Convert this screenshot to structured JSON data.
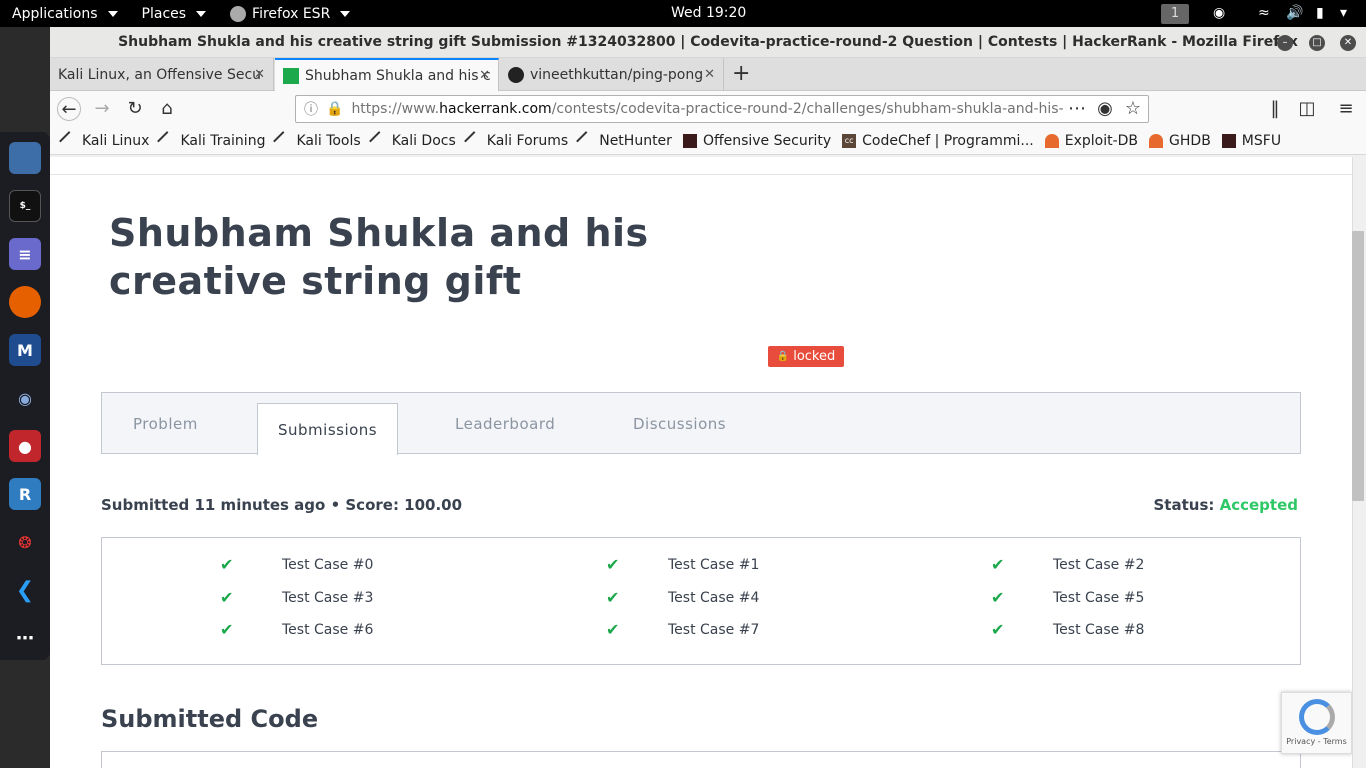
{
  "system": {
    "applications": "Applications",
    "places": "Places",
    "firefox_menu": "Firefox ESR",
    "clock": "Wed 19:20",
    "workspace": "1"
  },
  "window": {
    "title": "Shubham Shukla and his creative string gift Submission #1324032800 | Codevita-practice-round-2 Question | Contests | HackerRank - Mozilla Firefox"
  },
  "tabs": [
    {
      "label": "Kali Linux, an Offensive Secu"
    },
    {
      "label": "Shubham Shukla and his c"
    },
    {
      "label": "vineethkuttan/ping-pong"
    }
  ],
  "url": {
    "prefix": "https://www.",
    "domain": "hackerrank.com",
    "path": "/contests/codevita-practice-round-2/challenges/shubham-shukla-and-his-"
  },
  "bookmarks": [
    {
      "label": "Kali Linux"
    },
    {
      "label": "Kali Training"
    },
    {
      "label": "Kali Tools"
    },
    {
      "label": "Kali Docs"
    },
    {
      "label": "Kali Forums"
    },
    {
      "label": "NetHunter"
    },
    {
      "label": "Offensive Security"
    },
    {
      "label": "CodeChef | Programmi..."
    },
    {
      "label": "Exploit-DB"
    },
    {
      "label": "GHDB"
    },
    {
      "label": "MSFU"
    }
  ],
  "page": {
    "title": "Shubham Shukla and his creative string gift",
    "locked_badge": "locked",
    "tabs": [
      {
        "label": "Problem"
      },
      {
        "label": "Submissions"
      },
      {
        "label": "Leaderboard"
      },
      {
        "label": "Discussions"
      }
    ],
    "submitted": "Submitted 11 minutes ago • Score: 100.00",
    "status_label": "Status:",
    "status_value": "Accepted",
    "test_cases": [
      {
        "label": "Test Case #0"
      },
      {
        "label": "Test Case #1"
      },
      {
        "label": "Test Case #2"
      },
      {
        "label": "Test Case #3"
      },
      {
        "label": "Test Case #4"
      },
      {
        "label": "Test Case #5"
      },
      {
        "label": "Test Case #6"
      },
      {
        "label": "Test Case #7"
      },
      {
        "label": "Test Case #8"
      }
    ],
    "submitted_code_heading": "Submitted Code",
    "recaptcha_text": "Privacy - Terms"
  },
  "colors": {
    "accepted": "#2ec866",
    "locked": "#e74c3c",
    "check": "#1ba94c"
  }
}
